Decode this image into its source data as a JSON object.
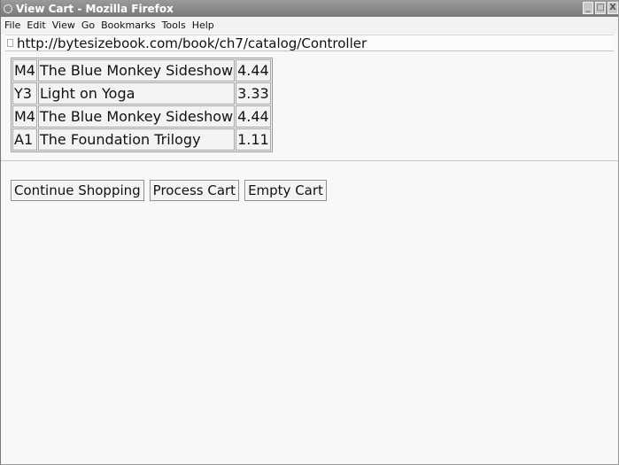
{
  "window": {
    "title": "View Cart - Mozilla Firefox",
    "minimize_glyph": "_",
    "maximize_glyph": "□",
    "close_glyph": "X"
  },
  "menu": {
    "items": [
      "File",
      "Edit",
      "View",
      "Go",
      "Bookmarks",
      "Tools",
      "Help"
    ]
  },
  "urlbar": {
    "value": "http://bytesizebook.com/book/ch7/catalog/Controller"
  },
  "cart": {
    "rows": [
      {
        "id": "M4",
        "title": "The Blue Monkey Sideshow",
        "price": "4.44"
      },
      {
        "id": "Y3",
        "title": "Light on Yoga",
        "price": "3.33"
      },
      {
        "id": "M4",
        "title": "The Blue Monkey Sideshow",
        "price": "4.44"
      },
      {
        "id": "A1",
        "title": "The Foundation Trilogy",
        "price": "1.11"
      }
    ]
  },
  "actions": {
    "continue_label": "Continue Shopping",
    "process_label": "Process Cart",
    "empty_label": "Empty Cart"
  }
}
